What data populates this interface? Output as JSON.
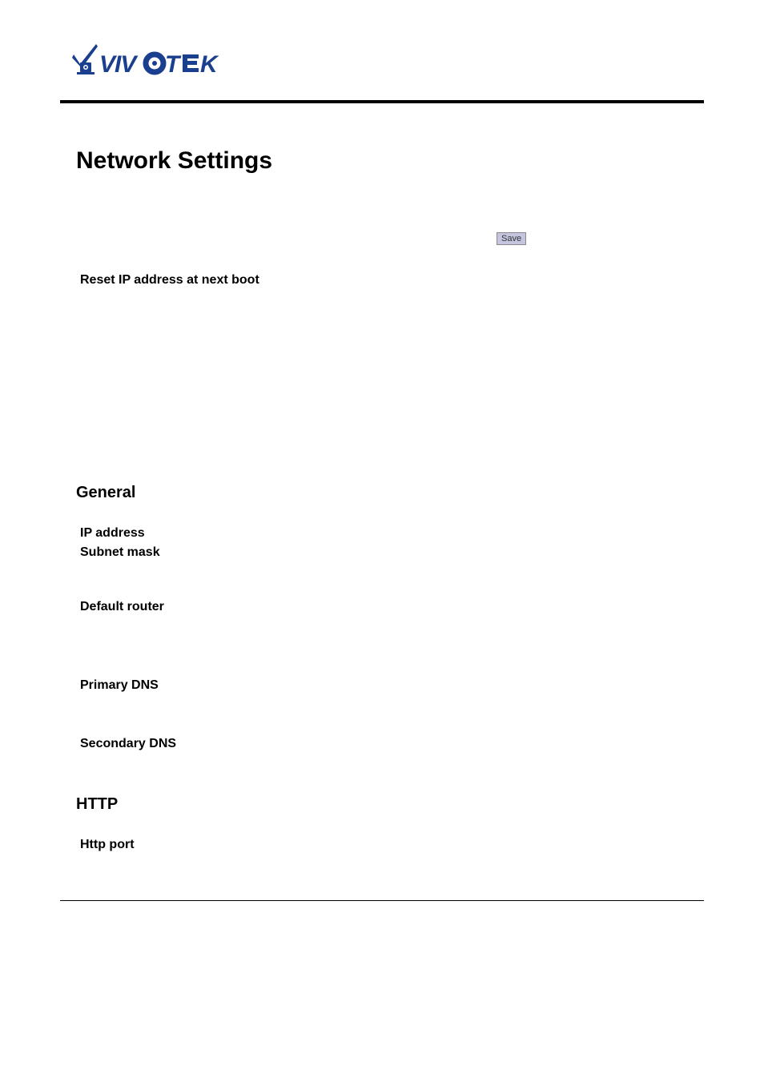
{
  "page_title": "Network Settings",
  "save_button_label": "Save",
  "reset_label": "Reset IP address at next boot",
  "sections": {
    "general": {
      "heading": "General",
      "fields": {
        "ip_address": "IP address",
        "subnet_mask": "Subnet mask",
        "default_router": "Default router",
        "primary_dns": "Primary DNS",
        "secondary_dns": "Secondary DNS"
      }
    },
    "http": {
      "heading": "HTTP",
      "fields": {
        "http_port": "Http port"
      }
    }
  },
  "brand": {
    "name": "VIVOTEK",
    "logo_colors": {
      "mark": "#1b3f8f",
      "text": "#1b3f8f"
    }
  }
}
